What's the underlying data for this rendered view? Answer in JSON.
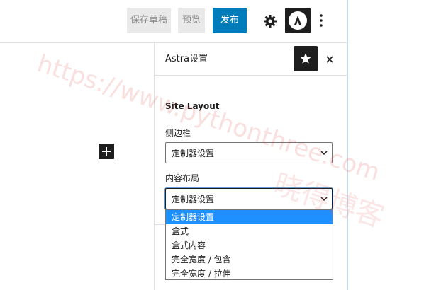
{
  "toolbar": {
    "save_draft_label": "保存草稿",
    "preview_label": "预览",
    "publish_label": "发布",
    "settings_icon": "gear-icon",
    "astra_icon": "astra-logo-icon",
    "more_icon": "vertical-ellipsis-icon"
  },
  "panel": {
    "title": "Astra设置",
    "star_icon": "star-icon",
    "close_icon": "close-icon",
    "section_title": "Site Layout",
    "sidebar": {
      "label": "侧边栏",
      "value": "定制器设置"
    },
    "content_layout": {
      "label": "内容布局",
      "value": "定制器设置",
      "options": [
        "定制器设置",
        "盒式",
        "盒式内容",
        "完全宽度 / 包含",
        "完全宽度 / 拉伸"
      ],
      "selected_index": 0
    }
  },
  "editor": {
    "add_block_icon": "plus-icon"
  },
  "watermark": {
    "url": "https://www.pythonthree.com",
    "name": "晓得博客"
  },
  "colors": {
    "publish": "#007cba",
    "selected_option": "#1e90ff",
    "dark": "#1e1e1e"
  }
}
